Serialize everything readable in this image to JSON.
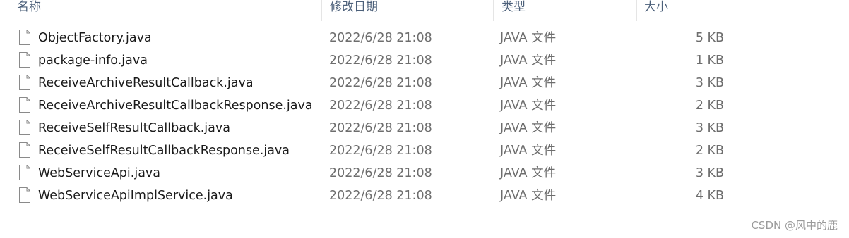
{
  "columns": {
    "name": "名称",
    "date": "修改日期",
    "type": "类型",
    "size": "大小"
  },
  "files": [
    {
      "name": "ObjectFactory.java",
      "date": "2022/6/28 21:08",
      "type": "JAVA 文件",
      "size": "5 KB"
    },
    {
      "name": "package-info.java",
      "date": "2022/6/28 21:08",
      "type": "JAVA 文件",
      "size": "1 KB"
    },
    {
      "name": "ReceiveArchiveResultCallback.java",
      "date": "2022/6/28 21:08",
      "type": "JAVA 文件",
      "size": "3 KB"
    },
    {
      "name": "ReceiveArchiveResultCallbackResponse.java",
      "date": "2022/6/28 21:08",
      "type": "JAVA 文件",
      "size": "2 KB"
    },
    {
      "name": "ReceiveSelfResultCallback.java",
      "date": "2022/6/28 21:08",
      "type": "JAVA 文件",
      "size": "3 KB"
    },
    {
      "name": "ReceiveSelfResultCallbackResponse.java",
      "date": "2022/6/28 21:08",
      "type": "JAVA 文件",
      "size": "2 KB"
    },
    {
      "name": "WebServiceApi.java",
      "date": "2022/6/28 21:08",
      "type": "JAVA 文件",
      "size": "3 KB"
    },
    {
      "name": "WebServiceApiImplService.java",
      "date": "2022/6/28 21:08",
      "type": "JAVA 文件",
      "size": "4 KB"
    }
  ],
  "file_icon": "document-icon",
  "watermark": "CSDN @风中的鹿"
}
